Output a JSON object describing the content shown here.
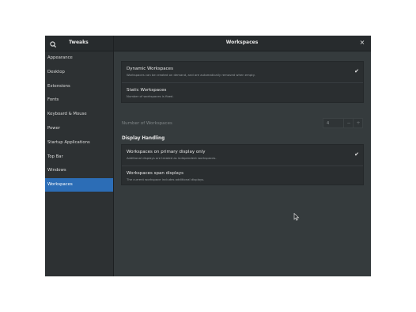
{
  "titlebar": {
    "app_title": "Tweaks",
    "page_title": "Workspaces",
    "search_icon": "search-icon",
    "close_icon": "close-icon",
    "close_glyph": "×"
  },
  "sidebar": {
    "items": [
      {
        "label": "Appearance"
      },
      {
        "label": "Desktop"
      },
      {
        "label": "Extensions"
      },
      {
        "label": "Fonts"
      },
      {
        "label": "Keyboard & Mouse"
      },
      {
        "label": "Power"
      },
      {
        "label": "Startup Applications"
      },
      {
        "label": "Top Bar"
      },
      {
        "label": "Windows"
      },
      {
        "label": "Workspaces"
      }
    ],
    "selected": "Workspaces"
  },
  "workspaces_mode": {
    "options": [
      {
        "title": "Dynamic Workspaces",
        "subtitle": "Workspaces can be created on demand, and are automatically removed when empty.",
        "checked": true
      },
      {
        "title": "Static Workspaces",
        "subtitle": "Number of workspaces is fixed.",
        "checked": false
      }
    ]
  },
  "number_of_workspaces": {
    "label": "Number of Workspaces",
    "value": "4",
    "decrement": "−",
    "increment": "+"
  },
  "display_handling": {
    "heading": "Display Handling",
    "options": [
      {
        "title": "Workspaces on primary display only",
        "subtitle": "Additional displays are treated as independent workspaces.",
        "checked": true
      },
      {
        "title": "Workspaces span displays",
        "subtitle": "The current workspace includes additional displays.",
        "checked": false
      }
    ]
  },
  "check_glyph": "✔",
  "colors": {
    "accent": "#2c6db6",
    "window_bg": "#353b3d",
    "sidebar_bg": "#2d3133",
    "panel_bg": "#2a2e30"
  }
}
